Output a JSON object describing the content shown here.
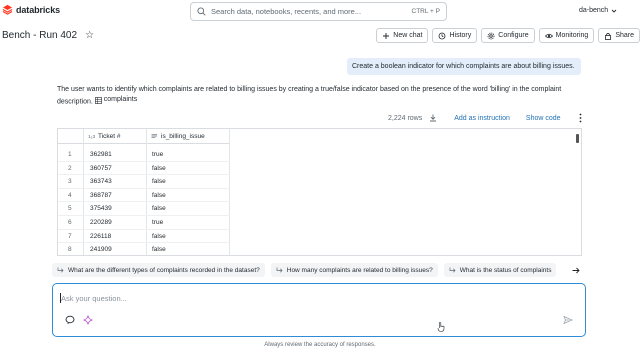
{
  "app": {
    "brand": "databricks",
    "search_placeholder": "Search data, notebooks, recents, and more...",
    "search_shortcut": "CTRL + P",
    "workspace": "da-bench"
  },
  "page": {
    "title": "Bench - Run 402",
    "toolbar": {
      "new_chat": "New chat",
      "history": "History",
      "configure": "Configure",
      "monitoring": "Monitoring",
      "share": "Share"
    }
  },
  "chat": {
    "user_message": "Create a boolean indicator for which complaints are about billing issues.",
    "assistant_text": "The user wants to identify which complaints are related to billing issues by creating a true/false indicator based on the presence of the word 'billing' in the complaint description.",
    "table_ref": "complaints",
    "result": {
      "row_count": "2,224 rows",
      "add_instruction": "Add as instruction",
      "show_code": "Show code",
      "columns": [
        "Ticket #",
        "is_billing_issue"
      ],
      "rows": [
        [
          "1",
          "362981",
          "true"
        ],
        [
          "2",
          "360757",
          "false"
        ],
        [
          "3",
          "363743",
          "false"
        ],
        [
          "4",
          "368787",
          "false"
        ],
        [
          "5",
          "375439",
          "false"
        ],
        [
          "6",
          "220289",
          "true"
        ],
        [
          "7",
          "226118",
          "false"
        ],
        [
          "8",
          "241909",
          "false"
        ]
      ]
    },
    "suggestions": [
      "What are the different types of complaints recorded in the dataset?",
      "How many complaints are related to billing issues?",
      "What is the status of complaints"
    ],
    "input_placeholder": "Ask your question...",
    "footer_note": "Always review the accuracy of responses."
  },
  "colors": {
    "accent": "#2272b4",
    "user_bubble": "#e4eefb",
    "input_border": "#2e8bd8",
    "brand_red": "#ff3621"
  }
}
